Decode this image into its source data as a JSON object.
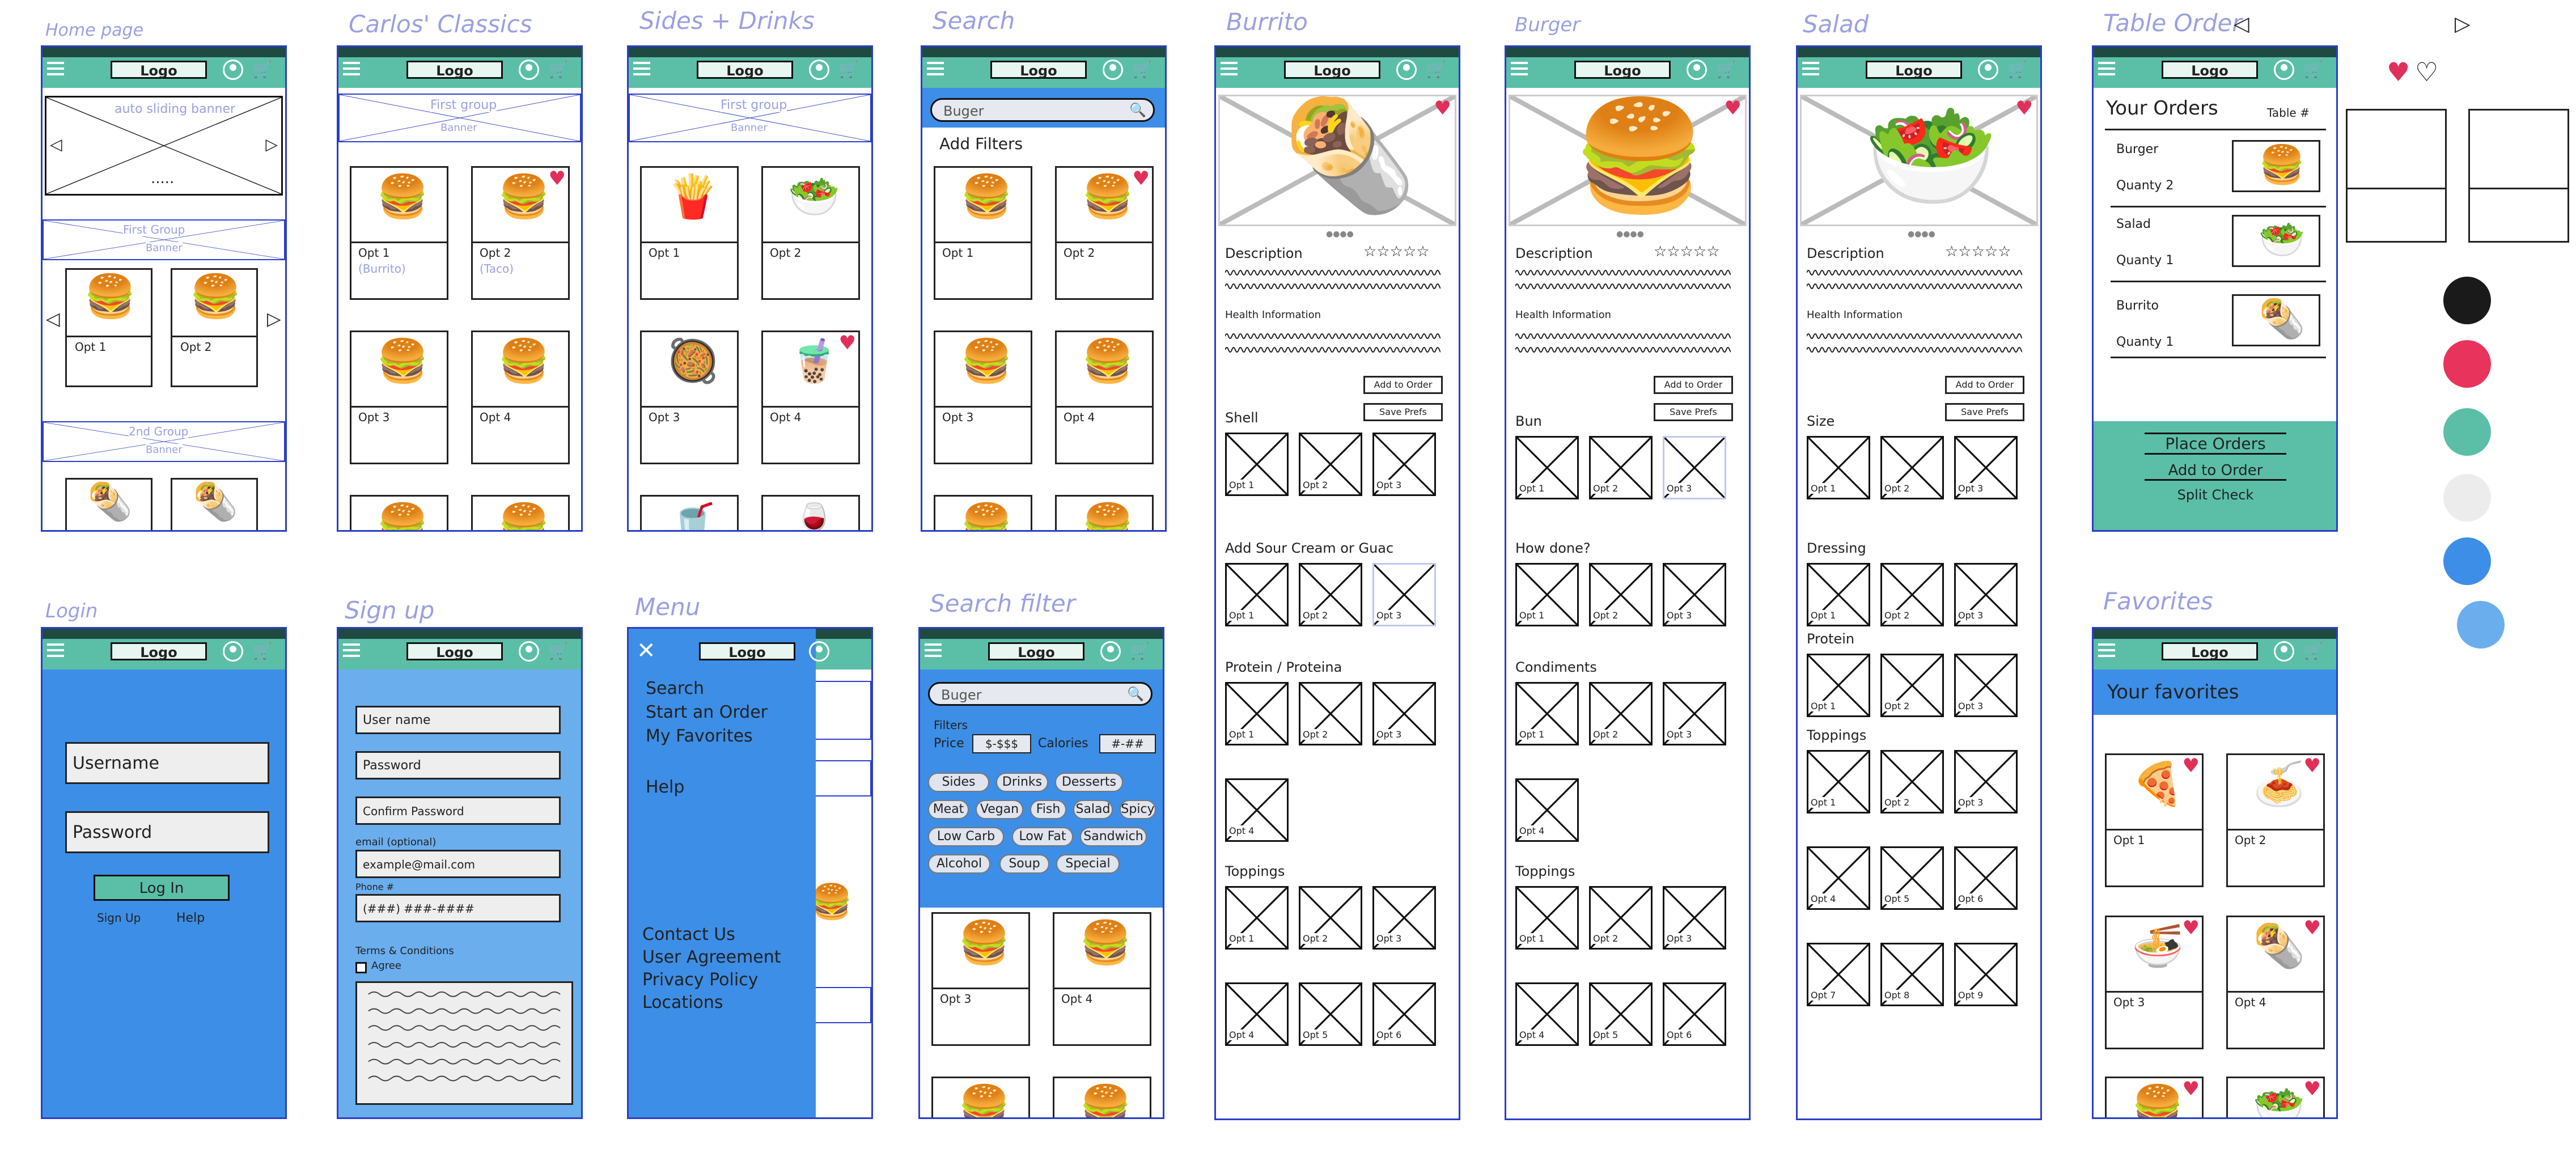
{
  "screens": {
    "home": {
      "title": "Home page",
      "banner1": "auto sliding banner",
      "dots": ".....",
      "banner2": "First Group",
      "banner2_sub": "Banner",
      "banner3": "2nd Group",
      "banner3_sub": "Banner",
      "opt1": "Opt 1",
      "opt2": "Opt 2"
    },
    "classics": {
      "title": "Carlos' Classics",
      "banner": "First group",
      "banner_sub": "Banner",
      "opt1": "Opt 1",
      "opt1_sub": "(Burrito)",
      "opt2": "Opt 2",
      "opt2_sub": "(Taco)",
      "opt3": "Opt 3",
      "opt4": "Opt 4"
    },
    "sides": {
      "title": "Sides + Drinks",
      "banner": "First group",
      "banner_sub": "Banner",
      "opt1": "Opt 1",
      "opt2": "Opt 2",
      "opt3": "Opt 3",
      "opt4": "Opt 4"
    },
    "search": {
      "title": "Search",
      "query": "Buger",
      "add_filters": "Add Filters",
      "opt1": "Opt 1",
      "opt2": "Opt 2",
      "opt3": "Opt 3",
      "opt4": "Opt 4"
    },
    "burrito": {
      "title": "Burrito",
      "description": "Description",
      "health": "Health Information",
      "add_to_order": "Add to Order",
      "save_prefs": "Save Prefs",
      "shell": "Shell",
      "sour": "Add Sour Cream or Guac",
      "protein": "Protein / Proteina",
      "toppings": "Toppings",
      "opts": [
        "Opt 1",
        "Opt 2",
        "Opt 3",
        "Opt 4",
        "Opt 5",
        "Opt 6"
      ]
    },
    "burger": {
      "title": "Burger",
      "description": "Description",
      "health": "Health Information",
      "add_to_order": "Add to Order",
      "save_prefs": "Save Prefs",
      "bun": "Bun",
      "how_done": "How done?",
      "condiments": "Condiments",
      "toppings": "Toppings",
      "opts": [
        "Opt 1",
        "Opt 2",
        "Opt 3",
        "Opt 4",
        "Opt 5",
        "Opt 6"
      ]
    },
    "salad": {
      "title": "Salad",
      "description": "Description",
      "health": "Health Information",
      "add_to_order": "Add to Order",
      "save_prefs": "Save Prefs",
      "size": "Size",
      "dressing": "Dressing",
      "protein": "Protein",
      "toppings": "Toppings",
      "opts": [
        "Opt 1",
        "Opt 2",
        "Opt 3",
        "Opt 4",
        "Opt 5",
        "Opt 6",
        "Opt 7",
        "Opt 8",
        "Opt 9"
      ]
    },
    "table_order": {
      "title": "Table Order",
      "heading": "Your Orders",
      "table_no": "Table #",
      "items": [
        {
          "name": "Burger",
          "qty": "Quanty 2"
        },
        {
          "name": "Salad",
          "qty": "Quanty 1"
        },
        {
          "name": "Burrito",
          "qty": "Quanty 1"
        }
      ],
      "place": "Place Orders",
      "add": "Add to Order",
      "split": "Split Check"
    },
    "login": {
      "title": "Login",
      "username": "Username",
      "password": "Password",
      "login": "Log In",
      "signup": "Sign Up",
      "help": "Help"
    },
    "signup": {
      "title": "Sign up",
      "user_name": "User name",
      "password": "Password",
      "confirm": "Confirm Password",
      "email_label": "email (optional)",
      "email": "example@mail.com",
      "phone_label": "Phone #",
      "phone": "(###) ###-####",
      "terms": "Terms & Conditions",
      "agree": "Agree"
    },
    "menu": {
      "title": "Menu",
      "items": [
        "Search",
        "Start an Order",
        "My Favorites",
        "Help"
      ],
      "footer": [
        "Contact Us",
        "User Agreement",
        "Privacy Policy",
        "Locations"
      ]
    },
    "search_filter": {
      "title": "Search filter",
      "query": "Buger",
      "filters": "Filters",
      "price": "Price",
      "price_val": "$-$$$",
      "calories": "Calories",
      "cal_val": "#-##",
      "chips": [
        "Sides",
        "Drinks",
        "Desserts",
        "Meat",
        "Vegan",
        "Fish",
        "Salad",
        "Spicy",
        "Low Carb",
        "Low Fat",
        "Sandwich",
        "Alcohol",
        "Soup",
        "Special"
      ],
      "opt3": "Opt 3",
      "opt4": "Opt 4"
    },
    "favorites": {
      "title": "Favorites",
      "heading": "Your favorites",
      "opt1": "Opt 1",
      "opt2": "Opt 2",
      "opt3": "Opt 3",
      "opt4": "Opt 4"
    }
  },
  "common": {
    "logo": "Logo"
  },
  "palette": [
    "#1a1a1a",
    "#e8345c",
    "#5bbfa8",
    "#ececec",
    "#3d8ee6",
    "#6aaeee"
  ]
}
